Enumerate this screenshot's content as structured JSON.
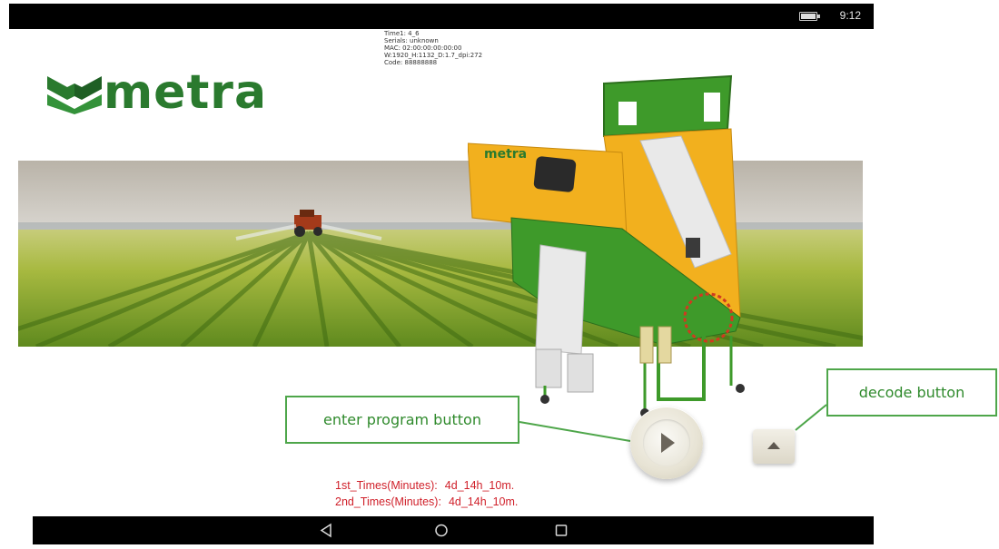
{
  "status_bar": {
    "time": "9:12",
    "battery_icon": "battery-icon"
  },
  "device_info": {
    "time1": "Time1:  4_6",
    "serials": "Serials:  unknown",
    "mac": "MAC:  02:00:00:00:00:00",
    "display": "W:1920_H:1132_D:1.7_dpi:272",
    "code": "Code:  88888888"
  },
  "logo": {
    "text": "metra",
    "color": "#2a7a2e"
  },
  "machine": {
    "brand_text": "metra"
  },
  "times": {
    "first_label": "1st_Times(Minutes):",
    "first_value": "4d_14h_10m.",
    "second_label": "2nd_Times(Minutes):",
    "second_value": "4d_14h_10m.",
    "color": "#d0202a"
  },
  "buttons": {
    "enter_program_icon": "play-icon",
    "decode_icon": "triangle-up-icon"
  },
  "callouts": {
    "enter_program": "enter program button",
    "decode": "decode button"
  },
  "nav_bar": {
    "back_icon": "back-triangle-icon",
    "home_icon": "home-circle-icon",
    "recents_icon": "recents-square-icon"
  },
  "colors": {
    "accent_green": "#4ea64a",
    "machine_yellow": "#f2b01e",
    "machine_green": "#3e9a2a"
  }
}
